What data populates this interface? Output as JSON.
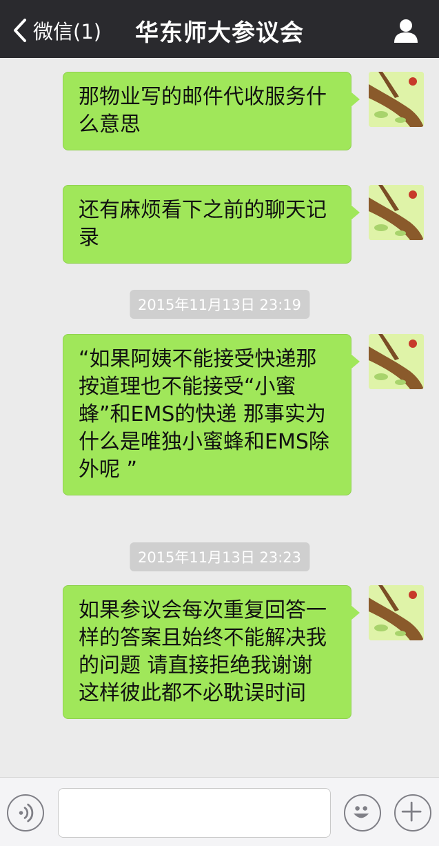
{
  "header": {
    "back_label": "微信(1)",
    "title": "华东师大参议会"
  },
  "messages": [
    {
      "text": "那物业写的邮件代收服务什么意思"
    },
    {
      "text": "还有麻烦看下之前的聊天记录"
    },
    {
      "text": "“如果阿姨不能接受快递那按道理也不能接受“小蜜蜂”和EMS的快递 那事实为什么是唯独小蜜蜂和EMS除外呢 ”"
    },
    {
      "text": "如果参议会每次重复回答一样的答案且始终不能解决我的问题 请直接拒绝我谢谢 这样彼此都不必耽误时间"
    }
  ],
  "timestamps": [
    "2015年11月13日 23:19",
    "2015年11月13日 23:23"
  ],
  "input": {
    "value": "",
    "placeholder": ""
  },
  "colors": {
    "header_bg": "#2a2a2e",
    "chat_bg": "#ebebeb",
    "bubble_bg": "#a0e75a"
  },
  "icons": {
    "back": "chevron-left-icon",
    "profile": "user-icon",
    "voice": "voice-icon",
    "emoji": "emoji-icon",
    "more": "plus-icon"
  }
}
